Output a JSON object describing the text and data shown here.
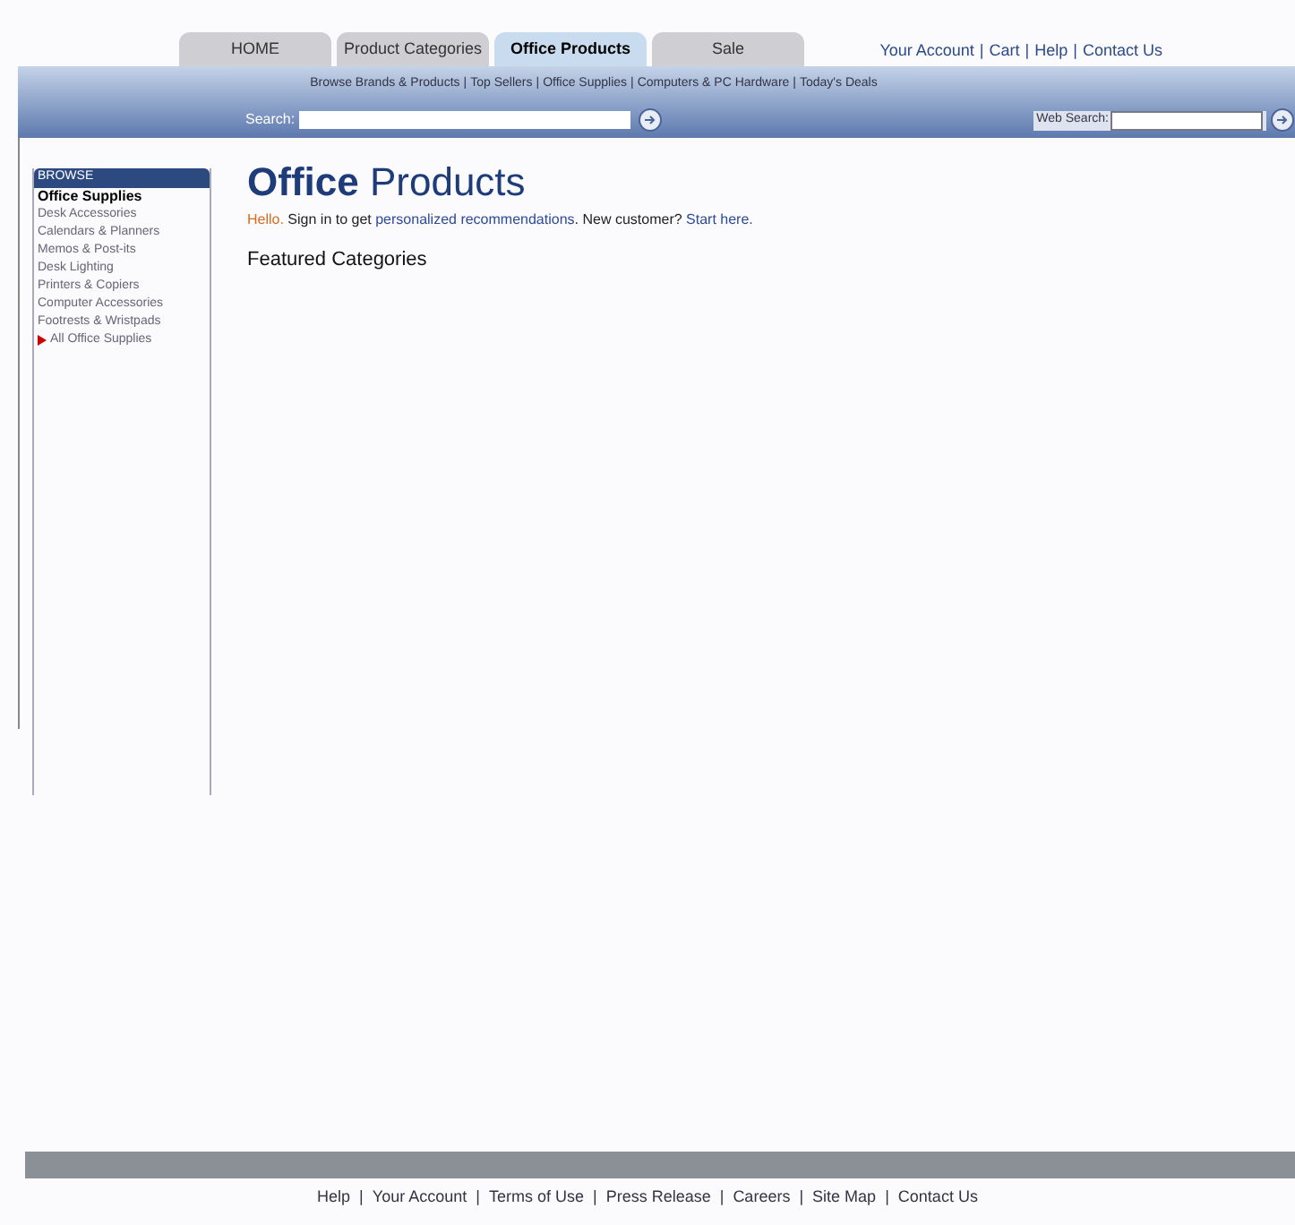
{
  "tabs": [
    {
      "label": "HOME",
      "selected": false
    },
    {
      "label": "Product Categories",
      "selected": false
    },
    {
      "label": "Office Products",
      "selected": true
    },
    {
      "label": "Sale",
      "selected": false
    }
  ],
  "account_links": {
    "separator": "|",
    "items": [
      "Your Account",
      "Cart",
      "Help",
      "Contact Us"
    ]
  },
  "subnav": {
    "separator": "|",
    "items": [
      "Browse Brands & Products",
      "Top Sellers",
      "Office Supplies",
      "Computers & PC Hardware",
      "Today's Deals"
    ]
  },
  "search": {
    "label": "Search:"
  },
  "web_search": {
    "label": "Web Search:"
  },
  "sidebar": {
    "title": "BROWSE",
    "items": [
      {
        "label": "Office Supplies",
        "selected": true,
        "kind": "link"
      },
      {
        "label": "Desk Accessories",
        "selected": false,
        "kind": "link"
      },
      {
        "label": "Calendars & Planners",
        "selected": false,
        "kind": "link"
      },
      {
        "label": "Memos & Post-its",
        "selected": false,
        "kind": "link"
      },
      {
        "label": "Desk Lighting",
        "selected": false,
        "kind": "link"
      },
      {
        "label": "Printers & Copiers",
        "selected": false,
        "kind": "link"
      },
      {
        "label": "Computer Accessories",
        "selected": false,
        "kind": "link"
      },
      {
        "label": "Footrests & Wristpads",
        "selected": false,
        "kind": "link"
      },
      {
        "label": "All Office Supplies",
        "selected": false,
        "kind": "more"
      }
    ]
  },
  "heading": "**Office** Products",
  "greeting": [
    {
      "kind": "greeting",
      "text": "Hello."
    },
    {
      "kind": "text",
      "text": " Sign in to get "
    },
    {
      "kind": "link",
      "text": "personalized recommendations"
    },
    {
      "kind": "text",
      "text": ". New customer? "
    },
    {
      "kind": "link",
      "text": "Start here."
    }
  ],
  "section_title": "Featured Categories",
  "footer_links": {
    "separator": "|",
    "items": [
      "Help",
      "Your Account",
      "Terms of Use",
      "Press Release",
      "Careers",
      "Site Map",
      "Contact Us"
    ]
  }
}
